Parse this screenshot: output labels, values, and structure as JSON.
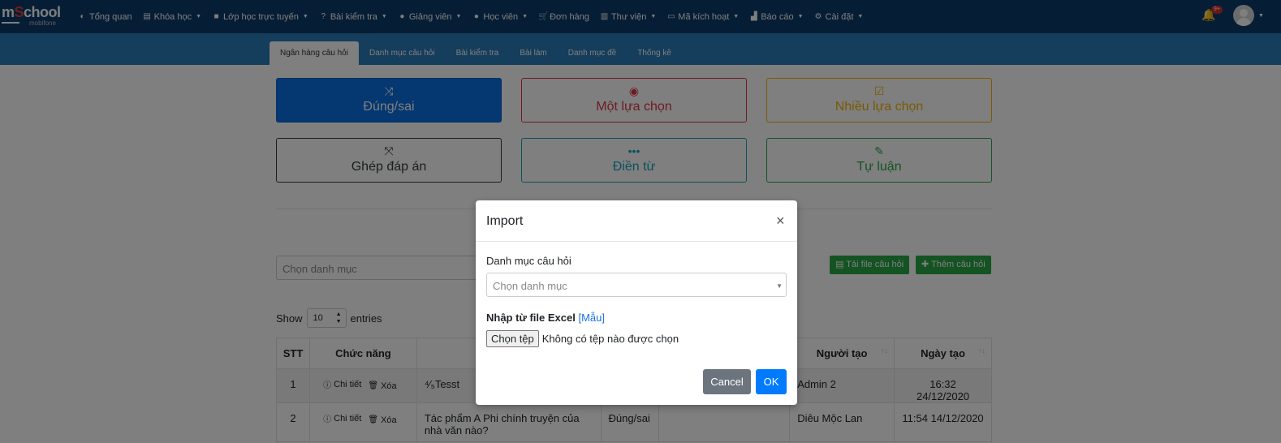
{
  "logo": {
    "part1": "m",
    "part_red": "S",
    "part2": "chool",
    "sub": "mobifone"
  },
  "topnav": {
    "items": [
      {
        "label": "Tổng quan",
        "icon": "dashboard-icon",
        "glyph": "◐",
        "caret": false
      },
      {
        "label": "Khóa học",
        "icon": "book-icon",
        "glyph": "▤",
        "caret": true
      },
      {
        "label": "Lớp học trực tuyến",
        "icon": "video-icon",
        "glyph": "■",
        "caret": true
      },
      {
        "label": "Bài kiểm tra",
        "icon": "question-icon",
        "glyph": "?",
        "caret": true
      },
      {
        "label": "Giảng viên",
        "icon": "users-icon",
        "glyph": "●",
        "caret": true
      },
      {
        "label": "Học viên",
        "icon": "user-icon",
        "glyph": "●",
        "caret": true
      },
      {
        "label": "Đơn hàng",
        "icon": "cart-icon",
        "glyph": "🛒",
        "caret": false
      },
      {
        "label": "Thư viện",
        "icon": "library-icon",
        "glyph": "▥",
        "caret": true
      },
      {
        "label": "Mã kích hoạt",
        "icon": "card-icon",
        "glyph": "▭",
        "caret": true
      },
      {
        "label": "Báo cáo",
        "icon": "chart-icon",
        "glyph": "▟",
        "caret": true
      },
      {
        "label": "Cài đặt",
        "icon": "gears-icon",
        "glyph": "⚙",
        "caret": true
      }
    ],
    "notification_badge": "9+"
  },
  "subnav": {
    "tabs": [
      {
        "label": "Ngân hàng câu hỏi",
        "active": true
      },
      {
        "label": "Danh mục câu hỏi",
        "active": false
      },
      {
        "label": "Bài kiểm tra",
        "active": false
      },
      {
        "label": "Bài làm",
        "active": false
      },
      {
        "label": "Danh mục đề",
        "active": false
      },
      {
        "label": "Thống kê",
        "active": false
      }
    ]
  },
  "question_types": [
    {
      "label": "Đúng/sai",
      "icon": "shuffle-icon",
      "glyph": "⤨",
      "color": "#ffffff",
      "border": "#0062cc",
      "bg": "#0a6fe0"
    },
    {
      "label": "Một lựa chọn",
      "icon": "dot-circle-icon",
      "glyph": "◉",
      "color": "#dc3545",
      "border": "#dc3545",
      "bg": "#ffffff"
    },
    {
      "label": "Nhiều lựa chọn",
      "icon": "check-square-icon",
      "glyph": "☑",
      "color": "#f0b400",
      "border": "#f0b400",
      "bg": "#ffffff"
    },
    {
      "label": "Ghép đáp án",
      "icon": "expand-icon",
      "glyph": "⤧",
      "color": "#343a40",
      "border": "#343a40",
      "bg": "#ffffff"
    },
    {
      "label": "Điền từ",
      "icon": "ellipsis-icon",
      "glyph": "•••",
      "color": "#17a2b8",
      "border": "#17a2b8",
      "bg": "#ffffff"
    },
    {
      "label": "Tự luận",
      "icon": "edit-icon",
      "glyph": "✎",
      "color": "#28a745",
      "border": "#28a745",
      "bg": "#ffffff"
    }
  ],
  "filter": {
    "category_placeholder": "Chọn danh mục"
  },
  "actions": {
    "upload": "Tải file câu hỏi",
    "add": "Thêm câu hỏi"
  },
  "length": {
    "show": "Show",
    "value": "10",
    "entries": "entries"
  },
  "table": {
    "headers": {
      "stt": "STT",
      "actions": "Chức năng",
      "creator": "Người tạo",
      "created": "Ngày tạo"
    },
    "detail_label": "Chi tiết",
    "delete_label": "Xóa",
    "rows": [
      {
        "stt": "1",
        "question": "⁴⁄₅Tesst",
        "type": "",
        "category": "",
        "creator": "Admin 2",
        "created": "16:32 24/12/2020"
      },
      {
        "stt": "2",
        "question": "Tác phẩm A Phi chính truyện của nhà văn nào?",
        "type": "Đúng/sai",
        "category": "",
        "creator": "Diêu Mộc Lan",
        "created": "11:54 14/12/2020"
      }
    ]
  },
  "modal": {
    "title": "Import",
    "category_label": "Danh mục câu hỏi",
    "category_placeholder": "Chọn danh mục",
    "import_label": "Nhập từ file Excel",
    "template_open": "[",
    "template_link": "Mẫu",
    "template_close": "]",
    "file_button": "Chọn tệp",
    "file_status": "Không có tệp nào được chọn",
    "cancel": "Cancel",
    "ok": "OK"
  }
}
